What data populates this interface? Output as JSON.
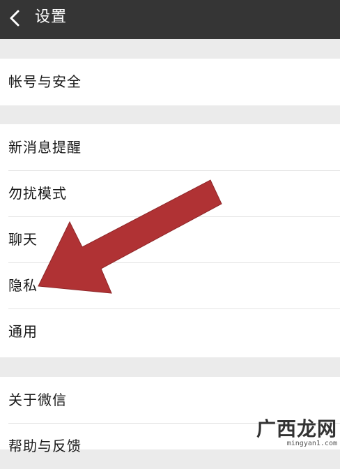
{
  "header": {
    "title": "设置",
    "back_icon": "chevron-left-icon",
    "background": "#353535"
  },
  "groups": [
    {
      "items": [
        {
          "label": "帐号与安全"
        }
      ]
    },
    {
      "items": [
        {
          "label": "新消息提醒"
        },
        {
          "label": "勿扰模式"
        },
        {
          "label": "聊天"
        },
        {
          "label": "隐私"
        },
        {
          "label": "通用"
        }
      ]
    },
    {
      "items": [
        {
          "label": "关于微信"
        },
        {
          "label": "帮助与反馈"
        }
      ]
    }
  ],
  "annotation": {
    "type": "arrow",
    "color": "#b03234",
    "points_to": "隐私"
  },
  "watermark": {
    "logo_text": "广西龙网",
    "site": "mingyan1.com"
  }
}
